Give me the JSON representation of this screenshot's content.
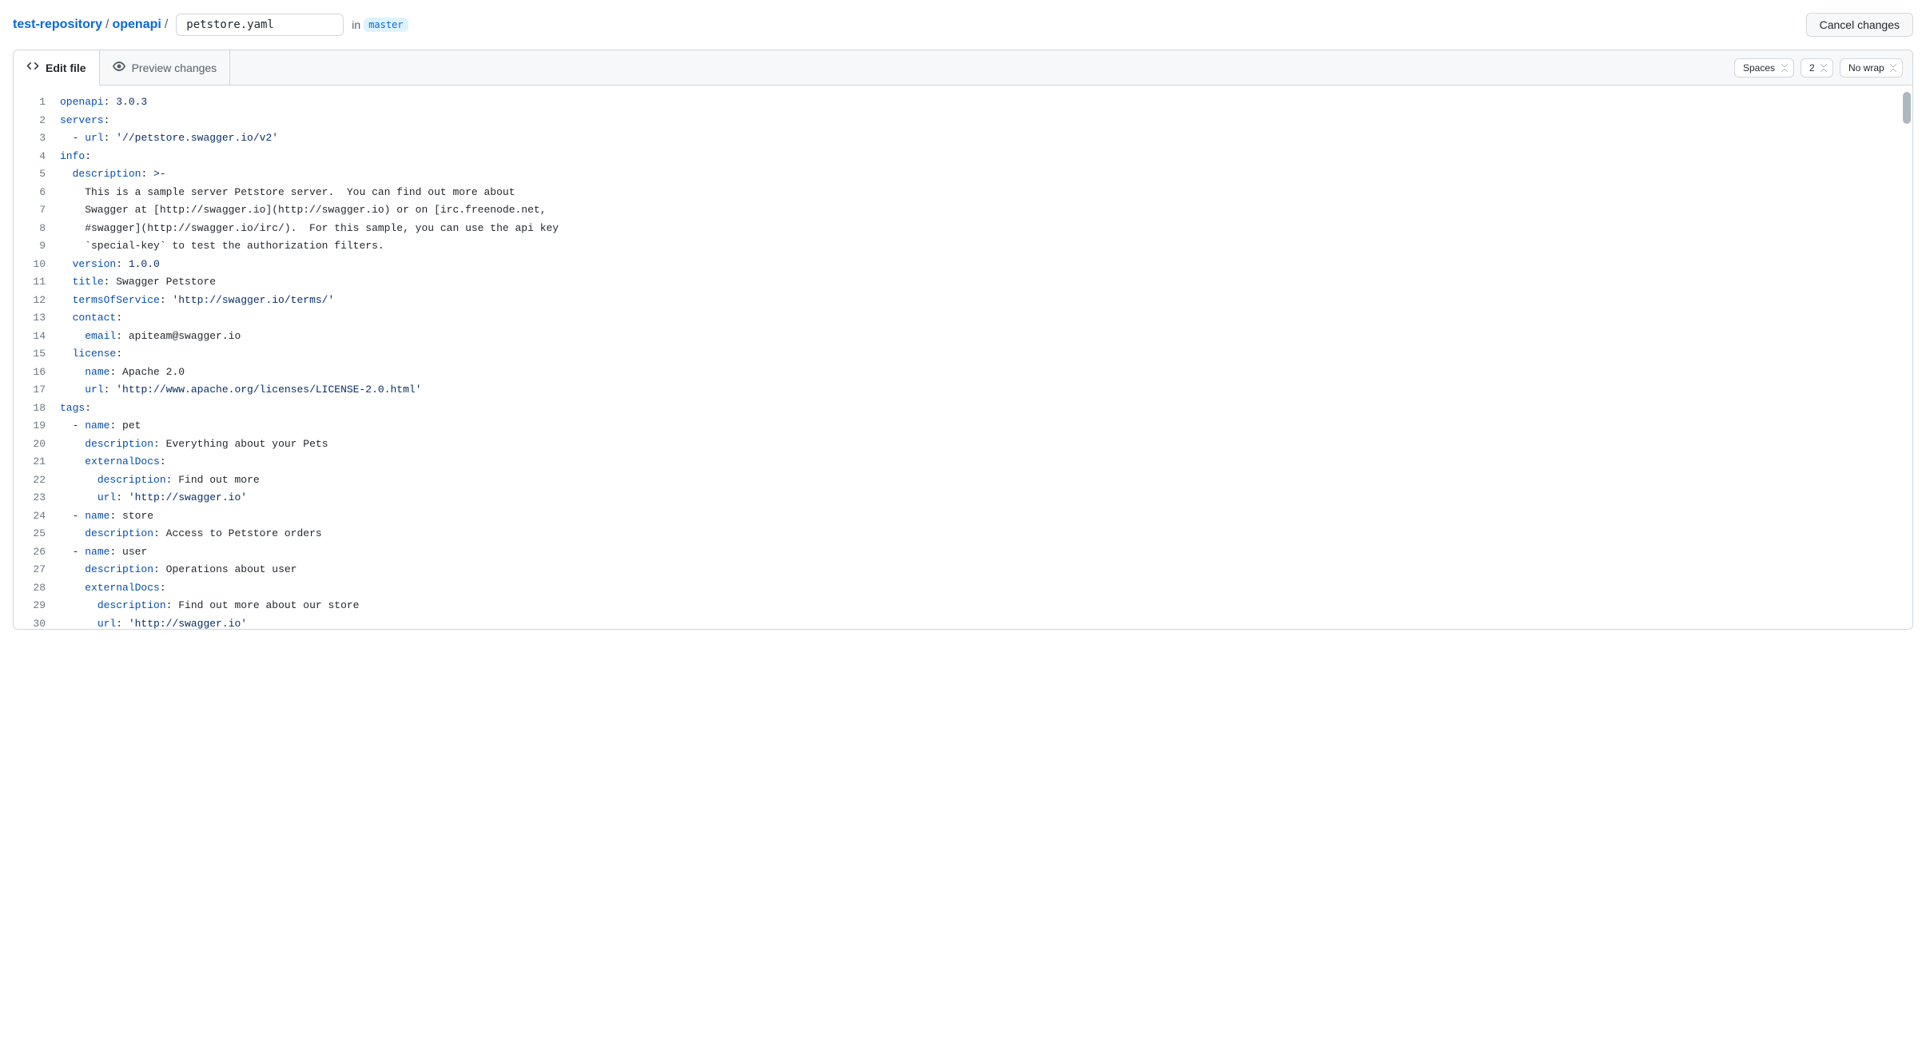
{
  "header": {
    "repo": "test-repository",
    "folder": "openapi",
    "filename": "petstore.yaml",
    "in_label": "in",
    "branch": "master",
    "cancel_label": "Cancel changes"
  },
  "tabs": {
    "edit": "Edit file",
    "preview": "Preview changes"
  },
  "toolbar": {
    "indent_mode": "Spaces",
    "indent_size": "2",
    "wrap_mode": "No wrap"
  },
  "code": {
    "lines": [
      [
        [
          "key",
          "openapi"
        ],
        [
          "punc",
          ": "
        ],
        [
          "str",
          "3.0.3"
        ]
      ],
      [
        [
          "key",
          "servers"
        ],
        [
          "punc",
          ":"
        ]
      ],
      [
        [
          "plain",
          "  - "
        ],
        [
          "key",
          "url"
        ],
        [
          "punc",
          ": "
        ],
        [
          "str",
          "'//petstore.swagger.io/v2'"
        ]
      ],
      [
        [
          "key",
          "info"
        ],
        [
          "punc",
          ":"
        ]
      ],
      [
        [
          "plain",
          "  "
        ],
        [
          "key",
          "description"
        ],
        [
          "punc",
          ": "
        ],
        [
          "str",
          ">-"
        ]
      ],
      [
        [
          "plain",
          "    This is a sample server Petstore server.  You can find out more about"
        ]
      ],
      [
        [
          "plain",
          "    Swagger at [http://swagger.io](http://swagger.io) or on [irc.freenode.net,"
        ]
      ],
      [
        [
          "plain",
          "    #swagger](http://swagger.io/irc/).  For this sample, you can use the api key"
        ]
      ],
      [
        [
          "plain",
          "    `special-key` to test the authorization filters."
        ]
      ],
      [
        [
          "plain",
          "  "
        ],
        [
          "key",
          "version"
        ],
        [
          "punc",
          ": "
        ],
        [
          "str",
          "1.0.0"
        ]
      ],
      [
        [
          "plain",
          "  "
        ],
        [
          "key",
          "title"
        ],
        [
          "punc",
          ": "
        ],
        [
          "plain",
          "Swagger Petstore"
        ]
      ],
      [
        [
          "plain",
          "  "
        ],
        [
          "key",
          "termsOfService"
        ],
        [
          "punc",
          ": "
        ],
        [
          "str",
          "'http://swagger.io/terms/'"
        ]
      ],
      [
        [
          "plain",
          "  "
        ],
        [
          "key",
          "contact"
        ],
        [
          "punc",
          ":"
        ]
      ],
      [
        [
          "plain",
          "    "
        ],
        [
          "key",
          "email"
        ],
        [
          "punc",
          ": "
        ],
        [
          "plain",
          "apiteam@swagger.io"
        ]
      ],
      [
        [
          "plain",
          "  "
        ],
        [
          "key",
          "license"
        ],
        [
          "punc",
          ":"
        ]
      ],
      [
        [
          "plain",
          "    "
        ],
        [
          "key",
          "name"
        ],
        [
          "punc",
          ": "
        ],
        [
          "plain",
          "Apache 2.0"
        ]
      ],
      [
        [
          "plain",
          "    "
        ],
        [
          "key",
          "url"
        ],
        [
          "punc",
          ": "
        ],
        [
          "str",
          "'http://www.apache.org/licenses/LICENSE-2.0.html'"
        ]
      ],
      [
        [
          "key",
          "tags"
        ],
        [
          "punc",
          ":"
        ]
      ],
      [
        [
          "plain",
          "  - "
        ],
        [
          "key",
          "name"
        ],
        [
          "punc",
          ": "
        ],
        [
          "plain",
          "pet"
        ]
      ],
      [
        [
          "plain",
          "    "
        ],
        [
          "key",
          "description"
        ],
        [
          "punc",
          ": "
        ],
        [
          "plain",
          "Everything about your Pets"
        ]
      ],
      [
        [
          "plain",
          "    "
        ],
        [
          "key",
          "externalDocs"
        ],
        [
          "punc",
          ":"
        ]
      ],
      [
        [
          "plain",
          "      "
        ],
        [
          "key",
          "description"
        ],
        [
          "punc",
          ": "
        ],
        [
          "plain",
          "Find out more"
        ]
      ],
      [
        [
          "plain",
          "      "
        ],
        [
          "key",
          "url"
        ],
        [
          "punc",
          ": "
        ],
        [
          "str",
          "'http://swagger.io'"
        ]
      ],
      [
        [
          "plain",
          "  - "
        ],
        [
          "key",
          "name"
        ],
        [
          "punc",
          ": "
        ],
        [
          "plain",
          "store"
        ]
      ],
      [
        [
          "plain",
          "    "
        ],
        [
          "key",
          "description"
        ],
        [
          "punc",
          ": "
        ],
        [
          "plain",
          "Access to Petstore orders"
        ]
      ],
      [
        [
          "plain",
          "  - "
        ],
        [
          "key",
          "name"
        ],
        [
          "punc",
          ": "
        ],
        [
          "plain",
          "user"
        ]
      ],
      [
        [
          "plain",
          "    "
        ],
        [
          "key",
          "description"
        ],
        [
          "punc",
          ": "
        ],
        [
          "plain",
          "Operations about user"
        ]
      ],
      [
        [
          "plain",
          "    "
        ],
        [
          "key",
          "externalDocs"
        ],
        [
          "punc",
          ":"
        ]
      ],
      [
        [
          "plain",
          "      "
        ],
        [
          "key",
          "description"
        ],
        [
          "punc",
          ": "
        ],
        [
          "plain",
          "Find out more about our store"
        ]
      ],
      [
        [
          "plain",
          "      "
        ],
        [
          "key",
          "url"
        ],
        [
          "punc",
          ": "
        ],
        [
          "str",
          "'http://swagger.io'"
        ]
      ]
    ]
  }
}
